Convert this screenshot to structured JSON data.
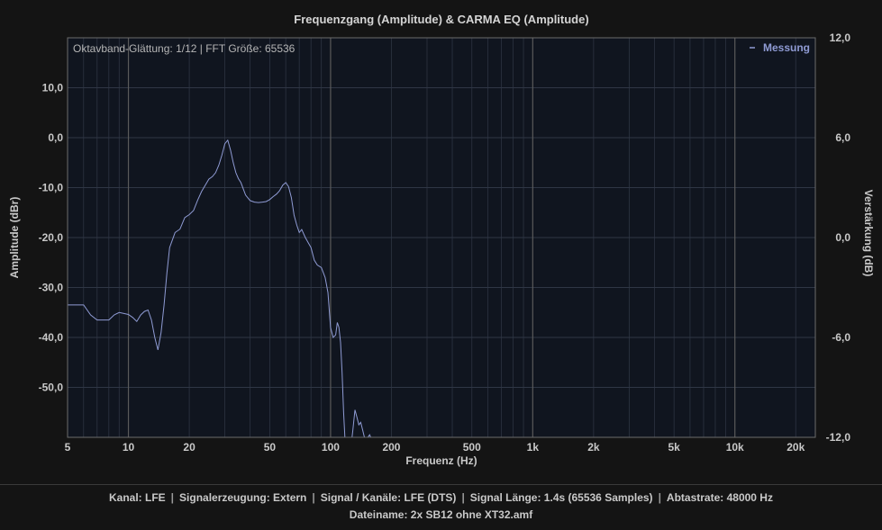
{
  "chart_data": {
    "type": "line",
    "title": "Frequenzgang (Amplitude) & CARMA EQ (Amplitude)",
    "xlabel": "Frequenz (Hz)",
    "ylabel": "Amplitude (dBr)",
    "y2label": "Verstärkung (dB)",
    "x_scale": "log",
    "xlim": [
      5,
      25000
    ],
    "ylim": [
      -60,
      20
    ],
    "y2lim": [
      -12,
      12
    ],
    "x_ticks": [
      {
        "value": 5,
        "label": "5"
      },
      {
        "value": 10,
        "label": "10"
      },
      {
        "value": 20,
        "label": "20"
      },
      {
        "value": 50,
        "label": "50"
      },
      {
        "value": 100,
        "label": "100"
      },
      {
        "value": 200,
        "label": "200"
      },
      {
        "value": 500,
        "label": "500"
      },
      {
        "value": 1000,
        "label": "1k"
      },
      {
        "value": 2000,
        "label": "2k"
      },
      {
        "value": 5000,
        "label": "5k"
      },
      {
        "value": 10000,
        "label": "10k"
      },
      {
        "value": 20000,
        "label": "20k"
      }
    ],
    "y_ticks": [
      {
        "value": 10,
        "label": "10,0"
      },
      {
        "value": 0,
        "label": "0,0"
      },
      {
        "value": -10,
        "label": "-10,0"
      },
      {
        "value": -20,
        "label": "-20,0"
      },
      {
        "value": -30,
        "label": "-30,0"
      },
      {
        "value": -40,
        "label": "-40,0"
      },
      {
        "value": -50,
        "label": "-50,0"
      }
    ],
    "y2_ticks": [
      {
        "value": 12,
        "label": "12,0"
      },
      {
        "value": 6,
        "label": "6,0"
      },
      {
        "value": 0,
        "label": "0,0"
      },
      {
        "value": -6,
        "label": "-6,0"
      },
      {
        "value": -12,
        "label": "-12,0"
      }
    ],
    "annotation": "Oktavband-Glättung: 1/12 | FFT Größe: 65536",
    "grid": true,
    "legend_position": "top-right",
    "series": [
      {
        "name": "Messung",
        "color": "#8f9bd4",
        "x": [
          5,
          6,
          6.5,
          7,
          7.5,
          8,
          8.5,
          9,
          9.5,
          10,
          10.5,
          11,
          11.5,
          12,
          12.5,
          13,
          13.5,
          14,
          14.5,
          15,
          15.5,
          16,
          17,
          18,
          19,
          20,
          21,
          22,
          23,
          24,
          25,
          26,
          27,
          28,
          29,
          30,
          31,
          32,
          33,
          34,
          35,
          36,
          38,
          40,
          42,
          44,
          46,
          48,
          50,
          52,
          54,
          56,
          58,
          60,
          62,
          64,
          66,
          68,
          70,
          72,
          75,
          78,
          80,
          83,
          86,
          90,
          94,
          97,
          100,
          103,
          106,
          108,
          110,
          112,
          114,
          116,
          118,
          120,
          123,
          126,
          129,
          132,
          135,
          138,
          141,
          144,
          147,
          150,
          153,
          156,
          160,
          165,
          170,
          175,
          180,
          185
        ],
        "y": [
          -33.5,
          -33.5,
          -35.5,
          -36.5,
          -36.5,
          -36.5,
          -35.5,
          -35,
          -35.2,
          -35.4,
          -36,
          -36.8,
          -35.5,
          -34.8,
          -34.5,
          -36.5,
          -40,
          -42.5,
          -39,
          -33.5,
          -27,
          -22,
          -19,
          -18.3,
          -16,
          -15.4,
          -14.6,
          -12.5,
          -10.8,
          -9.5,
          -8.3,
          -7.8,
          -7,
          -5.5,
          -3.5,
          -1.2,
          -0.5,
          -2.5,
          -5,
          -7,
          -8.2,
          -9,
          -11.5,
          -12.6,
          -12.9,
          -13,
          -12.9,
          -12.8,
          -12.4,
          -11.8,
          -11.3,
          -10.6,
          -9.5,
          -9,
          -9.8,
          -12,
          -15.5,
          -17.5,
          -19,
          -18.4,
          -20,
          -21.2,
          -22,
          -24.5,
          -25.5,
          -26,
          -28,
          -31,
          -38,
          -40,
          -39.5,
          -37,
          -38,
          -41,
          -47,
          -55,
          -61,
          -64,
          -64,
          -62,
          -58.5,
          -54.5,
          -56,
          -57.5,
          -57,
          -58.5,
          -60,
          -62,
          -60,
          -59.5,
          -60.5,
          -62,
          -61.5,
          -64,
          -62,
          -64
        ]
      }
    ]
  },
  "footer": {
    "kanal": "Kanal: LFE",
    "signalerzeugung": "Signalerzeugung: Extern",
    "signal_kanaele": "Signal / Kanäle: LFE (DTS)",
    "signal_laenge": "Signal Länge: 1.4s (65536 Samples)",
    "abtastrate": "Abtastrate: 48000 Hz",
    "dateiname": "Dateiname: 2x SB12 ohne XT32.amf"
  }
}
